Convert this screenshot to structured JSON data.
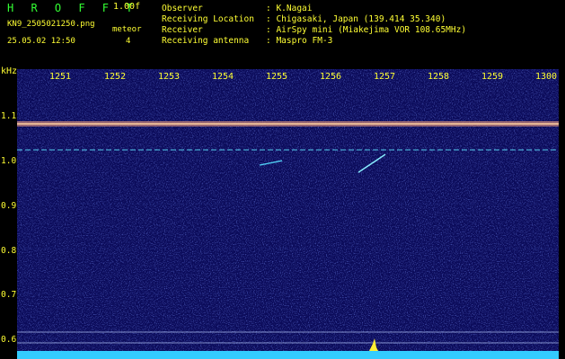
{
  "header": {
    "app_title": "H R O F F T",
    "version": "1.00f",
    "filename": "KN9_2505021250.png",
    "datetime": "25.05.02 12:50",
    "meteor_label": "meteor",
    "meteor_count": "4"
  },
  "info": {
    "observer_label": "Observer",
    "observer_value": ": K.Nagai",
    "location_label": "Receiving Location",
    "location_value": ": Chigasaki, Japan (139.414 35.340)",
    "receiver_label": "Receiver",
    "receiver_value": ": AirSpy mini (Miakejima VOR 108.65MHz)",
    "antenna_label": "Receiving antenna",
    "antenna_value": ": Maspro FM-3"
  },
  "axes": {
    "y_unit": "kHz",
    "y_ticks": [
      "1.1",
      "1.0",
      "0.9",
      "0.8",
      "0.7",
      "0.6"
    ],
    "x_ticks": [
      "1251",
      "1252",
      "1253",
      "1254",
      "1255",
      "1256",
      "1257",
      "1258",
      "1259",
      "1300"
    ]
  },
  "colors": {
    "background": "#000000",
    "text": "#ffff33",
    "title": "#33ff33",
    "spectrum_bg": "#0b0b5a",
    "noise_floor": "#33ccff"
  }
}
